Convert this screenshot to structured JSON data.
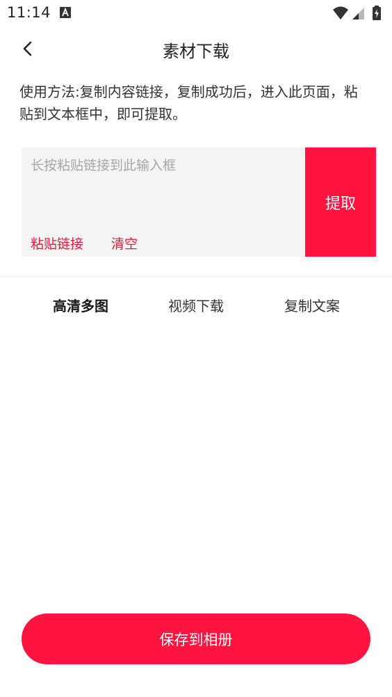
{
  "status_bar": {
    "time": "11:14",
    "icons": [
      "a-notification-icon",
      "wifi-icon",
      "signal-icon",
      "battery-charging-icon"
    ]
  },
  "header": {
    "title": "素材下载",
    "back_icon": "chevron-left-icon"
  },
  "instructions": {
    "text": "使用方法:复制内容链接，复制成功后，进入此页面，粘\n贴到文本框中，即可提取。"
  },
  "link_input": {
    "value": "",
    "placeholder": "长按粘贴链接到此输入框",
    "paste_label": "粘贴链接",
    "clear_label": "清空"
  },
  "extract": {
    "label": "提取"
  },
  "tabs": [
    {
      "label": "高清多图",
      "active": true
    },
    {
      "label": "视频下载",
      "active": false
    },
    {
      "label": "复制文案",
      "active": false
    }
  ],
  "footer": {
    "save_label": "保存到相册"
  },
  "colors": {
    "accent": "#ff153f",
    "accent_text": "#f0173e",
    "input_background": "#f4f4f4"
  }
}
